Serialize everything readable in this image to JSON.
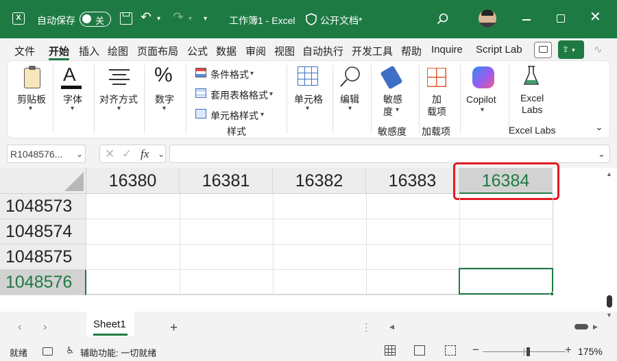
{
  "titlebar": {
    "autosave_label": "自动保存",
    "toggle_state": "关",
    "filename": "工作簿1 - Excel",
    "sensitivity": "公开文档*"
  },
  "menu": [
    "文件",
    "开始",
    "插入",
    "绘图",
    "页面布局",
    "公式",
    "数据",
    "审阅",
    "视图",
    "自动执行",
    "开发工具",
    "帮助",
    "Inquire",
    "Script Lab"
  ],
  "ribbon": {
    "clipboard": "剪贴板",
    "font": "字体",
    "alignment": "对齐方式",
    "number": "数字",
    "styles": {
      "conditional": "条件格式",
      "table": "套用表格格式",
      "cell": "单元格样式",
      "group": "样式"
    },
    "cells": "单元格",
    "editing": "编辑",
    "sensitivity": {
      "l1": "敏感",
      "l2": "度",
      "group": "敏感度"
    },
    "addins": {
      "l1": "加",
      "l2": "载项",
      "group": "加载项"
    },
    "copilot": "Copilot",
    "excellabs": {
      "l1": "Excel",
      "l2": "Labs",
      "group": "Excel Labs"
    }
  },
  "formula_bar": {
    "name_box": "R1048576...",
    "fx": "fx",
    "formula": ""
  },
  "grid": {
    "columns": [
      "16380",
      "16381",
      "16382",
      "16383",
      "16384"
    ],
    "rows": [
      "1048573",
      "1048574",
      "1048575",
      "1048576"
    ],
    "selected_column": "16384",
    "selected_row": "1048576",
    "accent": "#1e7a43",
    "highlight": "#e0191f"
  },
  "sheets": [
    "Sheet1"
  ],
  "status": {
    "ready": "就绪",
    "accessibility": "辅助功能: 一切就绪",
    "zoom": "175%"
  }
}
